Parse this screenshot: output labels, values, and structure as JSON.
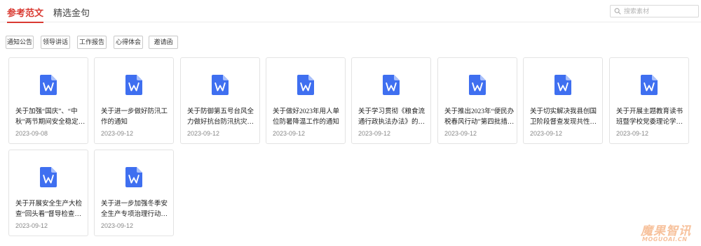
{
  "tabs": [
    {
      "label": "参考范文",
      "active": true
    },
    {
      "label": "精选金句",
      "active": false
    }
  ],
  "search": {
    "placeholder": "搜索素材",
    "icon": "search-icon"
  },
  "filters": [
    "通知公告",
    "领导讲话",
    "工作报告",
    "心得体会",
    "邀请函"
  ],
  "doc_icon": {
    "name": "wps-document-icon",
    "color": "#3f6ff0",
    "letter": "W"
  },
  "cards": [
    {
      "title": "关于加强“国庆”、“中秋”两节期间安全稳定…",
      "date": "2023-09-08"
    },
    {
      "title": "关于进一步做好防汛工作的通知",
      "date": "2023-09-12"
    },
    {
      "title": "关于防御第五号台风全力做好抗台防汛抗灾减灾…",
      "date": "2023-09-12"
    },
    {
      "title": "关于做好2023年用人单位防暑降温工作的通知",
      "date": "2023-09-12"
    },
    {
      "title": "关于学习贯彻《粮食流通行政执法办法》的通知",
      "date": "2023-09-12"
    },
    {
      "title": "关于推出2023年“便民办税春风行动”第四批措…",
      "date": "2023-09-12"
    },
    {
      "title": "关于切实解决我县创国卫阶段督查发现共性问题…",
      "date": "2023-09-12"
    },
    {
      "title": "关于开展主题教育读书班暨学校党委理论学习中…",
      "date": "2023-09-12"
    },
    {
      "title": "关于开展安全生产大检查“回头看”督导检查的…",
      "date": "2023-09-12"
    },
    {
      "title": "关于进一步加强冬季安全生产专项治理行动督导…",
      "date": "2023-09-12"
    }
  ],
  "watermark": {
    "cn": "魔果智讯",
    "en": "MOGUOAI.CN"
  },
  "colors": {
    "accent": "#d93a32",
    "doc_icon": "#3f6ff0",
    "watermark": "#f7c29d"
  }
}
